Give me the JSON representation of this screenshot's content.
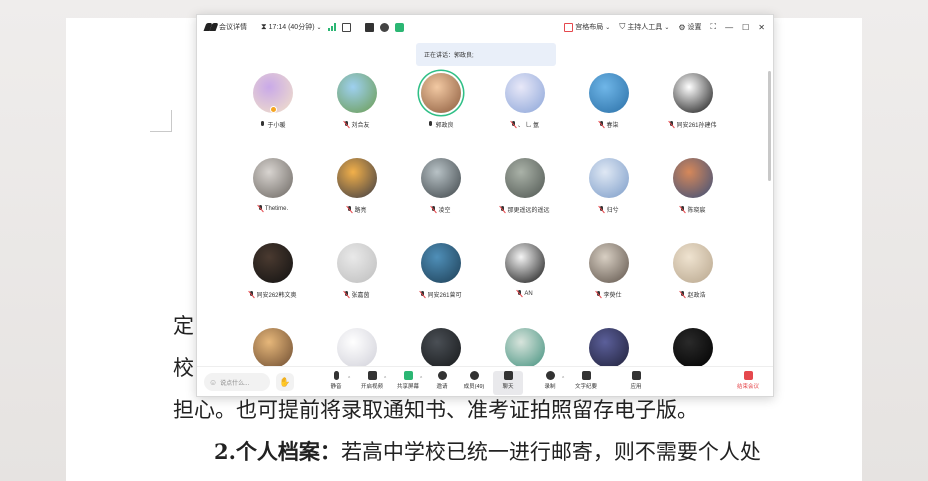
{
  "document": {
    "line1_char": "定",
    "line2_char": "校",
    "line3": "担心。也可提前将录取通知书、准考证拍照留存电子版。",
    "line4_bold": "2.个人档案：",
    "line4_rest": "若高中学校已统一进行邮寄，则不需要个人处"
  },
  "titlebar": {
    "details_label": "会议详情",
    "timer": "17:14 (40分钟)",
    "layout_label": "宫格布局",
    "host_tools_label": "主持人工具",
    "settings_label": "设置"
  },
  "speaking": "正在讲话：郭政良;",
  "participants": [
    {
      "name": "于小暖",
      "muted": false,
      "active": false,
      "host": true,
      "color1": "#c9a9e8",
      "color2": "#f3e2c8"
    },
    {
      "name": "刘合友",
      "muted": true,
      "active": false,
      "host": false,
      "color1": "#9ed0f0",
      "color2": "#6a9b4e"
    },
    {
      "name": "郭政良",
      "muted": false,
      "active": true,
      "host": false,
      "color1": "#f2c9a3",
      "color2": "#8b5a3c"
    },
    {
      "name": "、 乚 氬",
      "muted": true,
      "active": false,
      "host": false,
      "color1": "#e8e8f8",
      "color2": "#8aa4d8"
    },
    {
      "name": "春柒",
      "muted": true,
      "active": false,
      "host": false,
      "color1": "#6fb6e8",
      "color2": "#2a6fa6"
    },
    {
      "name": "同安261孙建伟",
      "muted": true,
      "active": false,
      "host": false,
      "color1": "#ffffff",
      "color2": "#111111"
    },
    {
      "name": "Thetime.",
      "muted": true,
      "active": false,
      "host": false,
      "color1": "#d8d4d0",
      "color2": "#6b6661"
    },
    {
      "name": "路亮",
      "muted": true,
      "active": false,
      "host": false,
      "color1": "#f2b04a",
      "color2": "#3a3a44"
    },
    {
      "name": "凌空",
      "muted": true,
      "active": false,
      "host": false,
      "color1": "#b8c2c6",
      "color2": "#3d4448"
    },
    {
      "name": "那更遥远的遥远",
      "muted": true,
      "active": false,
      "host": false,
      "color1": "#aab2a8",
      "color2": "#4e5550"
    },
    {
      "name": "归兮",
      "muted": true,
      "active": false,
      "host": false,
      "color1": "#dfe8f4",
      "color2": "#7b9bc8"
    },
    {
      "name": "陈晓宸",
      "muted": true,
      "active": false,
      "host": false,
      "color1": "#d6885a",
      "color2": "#3a4f7a"
    },
    {
      "name": "同安262韩文奥",
      "muted": true,
      "active": false,
      "host": false,
      "color1": "#4a3a30",
      "color2": "#111111"
    },
    {
      "name": "张嘉茵",
      "muted": true,
      "active": false,
      "host": false,
      "color1": "#e9e9e9",
      "color2": "#bdbdbd"
    },
    {
      "name": "同安261曾可",
      "muted": true,
      "active": false,
      "host": false,
      "color1": "#4f8fb8",
      "color2": "#1d3e55"
    },
    {
      "name": "AN",
      "muted": true,
      "active": false,
      "host": false,
      "color1": "#f4f4f4",
      "color2": "#111111"
    },
    {
      "name": "李熒仕",
      "muted": true,
      "active": false,
      "host": false,
      "color1": "#d8cfc3",
      "color2": "#5d5249"
    },
    {
      "name": "赵政浩",
      "muted": true,
      "active": false,
      "host": false,
      "color1": "#efe3d0",
      "color2": "#b7a58c"
    },
    {
      "name": "",
      "muted": true,
      "active": false,
      "host": false,
      "color1": "#e6b77a",
      "color2": "#6b4a2f"
    },
    {
      "name": "",
      "muted": true,
      "active": false,
      "host": false,
      "color1": "#ffffff",
      "color2": "#cfcfd8"
    },
    {
      "name": "",
      "muted": true,
      "active": false,
      "host": false,
      "color1": "#4a4f55",
      "color2": "#16181a"
    },
    {
      "name": "",
      "muted": true,
      "active": false,
      "host": false,
      "color1": "#d8e4dc",
      "color2": "#3f8f7c"
    },
    {
      "name": "",
      "muted": true,
      "active": false,
      "host": false,
      "color1": "#5b5f9a",
      "color2": "#1f2038"
    },
    {
      "name": "",
      "muted": true,
      "active": false,
      "host": false,
      "color1": "#2a2a2a",
      "color2": "#000000"
    }
  ],
  "toolbar": {
    "say_placeholder": "说点什么...",
    "mute": "静音",
    "video": "开启视频",
    "share": "共享屏幕",
    "invite": "邀请",
    "members": "成员(49)",
    "chat": "聊天",
    "record": "录制",
    "minutes": "文字纪要",
    "apps": "应用",
    "end": "结束会议"
  },
  "colors": {
    "accent_green": "#2fbf86",
    "end_red": "#e5484d"
  }
}
